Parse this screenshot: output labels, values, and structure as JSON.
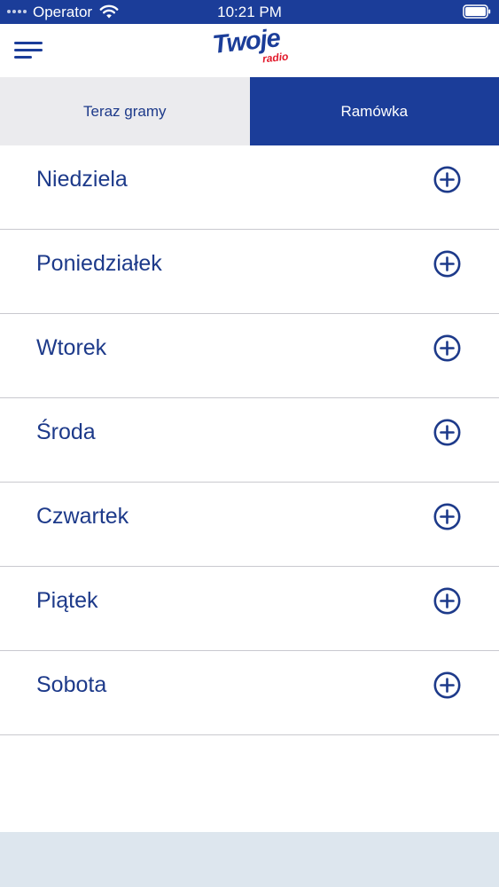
{
  "status_bar": {
    "carrier": "Operator",
    "time": "10:21 PM"
  },
  "header": {
    "logo_main": "Twoje",
    "logo_sub": "radio"
  },
  "tabs": [
    {
      "label": "Teraz gramy",
      "active": false
    },
    {
      "label": "Ramówka",
      "active": true
    }
  ],
  "days": [
    {
      "label": "Niedziela"
    },
    {
      "label": "Poniedziałek"
    },
    {
      "label": "Wtorek"
    },
    {
      "label": "Środa"
    },
    {
      "label": "Czwartek"
    },
    {
      "label": "Piątek"
    },
    {
      "label": "Sobota"
    }
  ],
  "colors": {
    "brand_blue": "#1b3d99",
    "text_blue": "#1d3a8a",
    "logo_red": "#e2192b",
    "inactive_tab_bg": "#ebebee",
    "divider": "#c9c9cf",
    "bottom_bar": "#dde6ee"
  },
  "icons": {
    "menu": "hamburger-menu-icon",
    "expand": "plus-circle-icon",
    "wifi": "wifi-icon",
    "battery": "battery-icon",
    "signal": "signal-icon"
  }
}
